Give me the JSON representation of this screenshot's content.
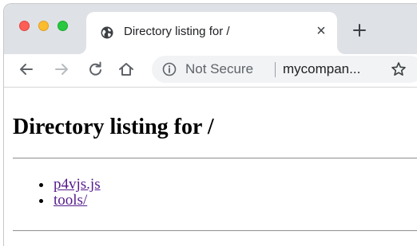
{
  "tab": {
    "title": "Directory listing for /",
    "close_glyph": "×"
  },
  "toolbar": {
    "security_label": "Not Secure",
    "url": "mycompan..."
  },
  "page": {
    "heading": "Directory listing for /",
    "entries": [
      {
        "label": "p4vjs.js"
      },
      {
        "label": "tools/"
      }
    ]
  },
  "colors": {
    "tabstrip_bg": "#dee1e6",
    "omnibox_bg": "#f1f3f4",
    "visited_link": "#551a8b",
    "traffic_red": "#fd5f57",
    "traffic_yellow": "#fdbc2e",
    "traffic_green": "#28c840"
  },
  "icons": {
    "favicon": "globe-icon",
    "new_tab": "plus-icon",
    "back": "arrow-left-icon",
    "forward": "arrow-right-icon",
    "reload": "reload-icon",
    "home": "home-icon",
    "info": "info-icon",
    "bookmark": "star-icon"
  }
}
